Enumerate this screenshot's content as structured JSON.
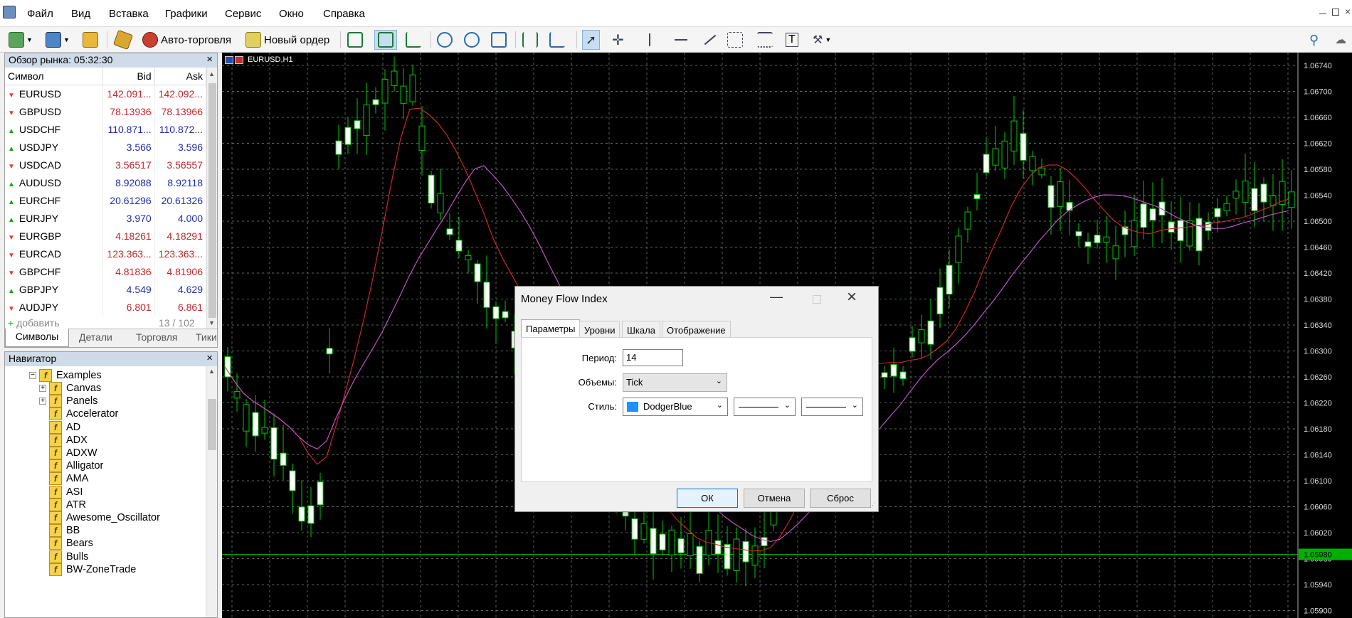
{
  "menu": [
    "Файл",
    "Вид",
    "Вставка",
    "Графики",
    "Сервис",
    "Окно",
    "Справка"
  ],
  "toolbar": {
    "auto_trading": "Авто-торговля",
    "new_order": "Новый ордер"
  },
  "market_watch": {
    "title": "Обзор рынка: 05:32:30",
    "columns": [
      "Символ",
      "Bid",
      "Ask"
    ],
    "rows": [
      {
        "symbol": "EURUSD",
        "bid": "142.091...",
        "ask": "142.092...",
        "dir": "down",
        "color": "red"
      },
      {
        "symbol": "GBPUSD",
        "bid": "78.13936",
        "ask": "78.13966",
        "dir": "down",
        "color": "red"
      },
      {
        "symbol": "USDCHF",
        "bid": "110.871...",
        "ask": "110.872...",
        "dir": "up",
        "color": "blue"
      },
      {
        "symbol": "USDJPY",
        "bid": "3.566",
        "ask": "3.596",
        "dir": "up",
        "color": "blue"
      },
      {
        "symbol": "USDCAD",
        "bid": "3.56517",
        "ask": "3.56557",
        "dir": "down",
        "color": "red"
      },
      {
        "symbol": "AUDUSD",
        "bid": "8.92088",
        "ask": "8.92118",
        "dir": "up",
        "color": "blue"
      },
      {
        "symbol": "EURCHF",
        "bid": "20.61296",
        "ask": "20.61326",
        "dir": "up",
        "color": "blue"
      },
      {
        "symbol": "EURJPY",
        "bid": "3.970",
        "ask": "4.000",
        "dir": "up",
        "color": "blue"
      },
      {
        "symbol": "EURGBP",
        "bid": "4.18261",
        "ask": "4.18291",
        "dir": "down",
        "color": "red"
      },
      {
        "symbol": "EURCAD",
        "bid": "123.363...",
        "ask": "123.363...",
        "dir": "down",
        "color": "red"
      },
      {
        "symbol": "GBPCHF",
        "bid": "4.81836",
        "ask": "4.81906",
        "dir": "down",
        "color": "red"
      },
      {
        "symbol": "GBPJPY",
        "bid": "4.549",
        "ask": "4.629",
        "dir": "up",
        "color": "blue"
      },
      {
        "symbol": "AUDJPY",
        "bid": "6.801",
        "ask": "6.861",
        "dir": "down",
        "color": "red"
      }
    ],
    "add_label": "добавить",
    "count": "13 / 102",
    "tabs": [
      "Символы",
      "Детали",
      "Торговля",
      "Тики"
    ]
  },
  "navigator": {
    "title": "Навигатор",
    "folder": "Examples",
    "subfolders": [
      "Canvas",
      "Panels"
    ],
    "items": [
      "Accelerator",
      "AD",
      "ADX",
      "ADXW",
      "Alligator",
      "AMA",
      "ASI",
      "ATR",
      "Awesome_Oscillator",
      "BB",
      "Bears",
      "Bulls",
      "BW-ZoneTrade"
    ]
  },
  "chart": {
    "symbol_label": "EURUSD,H1",
    "price_labels": [
      "1.06740",
      "1.06700",
      "1.06660",
      "1.06620",
      "1.06580",
      "1.06540",
      "1.06500",
      "1.06460",
      "1.06420",
      "1.06380",
      "1.06340",
      "1.06300",
      "1.06260",
      "1.06220",
      "1.06180",
      "1.06140",
      "1.06100",
      "1.06060",
      "1.06020",
      "1.05980",
      "1.05940",
      "1.05900"
    ],
    "current_price": "1.05980",
    "colors": {
      "bg": "#000000",
      "grid": "#5a6a5a",
      "candle": "#00c800",
      "ma_red": "#c82828",
      "ma_violet": "#c050c8",
      "current": "#00b000"
    }
  },
  "dialog": {
    "title": "Money Flow Index",
    "tabs": [
      "Параметры",
      "Уровни",
      "Шкала",
      "Отображение"
    ],
    "period_label": "Период:",
    "period_value": "14",
    "volumes_label": "Объемы:",
    "volumes_value": "Tick",
    "style_label": "Стиль:",
    "color_value": "DodgerBlue",
    "color_hex": "#1e90ff",
    "ok": "ОК",
    "cancel": "Отмена",
    "reset": "Сброс"
  }
}
